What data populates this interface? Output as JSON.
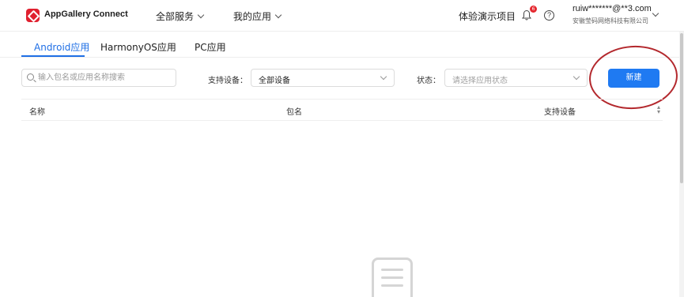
{
  "header": {
    "brand": "AppGallery Connect",
    "nav": [
      "全部服务",
      "我的应用"
    ],
    "demo": "体验演示项目",
    "notification_count": "6",
    "help_symbol": "?",
    "user_email": "ruiw*******@**3.com",
    "user_company": "安徽莹码网络科技有限公司"
  },
  "tabs": [
    "Android应用",
    "HarmonyOS应用",
    "PC应用"
  ],
  "filters": {
    "search_placeholder": "输入包名或应用名称搜索",
    "device_label": "支持设备：",
    "device_value": "全部设备",
    "status_label": "状态：",
    "status_placeholder": "请选择应用状态"
  },
  "new_button": "新建",
  "table": {
    "columns": [
      "名称",
      "包名",
      "支持设备"
    ],
    "rows": []
  },
  "colors": {
    "accent": "#1f7af2",
    "active_tab": "#1f6fe5",
    "brand_red": "#e0202f",
    "annotation": "#b3282d"
  },
  "icons": [
    "app-logo-icon",
    "chevron-down-icon",
    "bell-icon",
    "help-icon",
    "search-icon",
    "sort-icon",
    "empty-document-icon"
  ]
}
